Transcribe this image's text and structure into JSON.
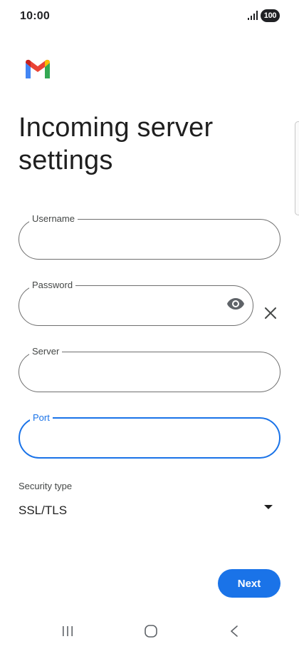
{
  "status_bar": {
    "time": "10:00",
    "battery": "100",
    "signal_icon": "signal-icon"
  },
  "app": {
    "logo": "gmail-logo",
    "brand_colors": {
      "blue": "#4285F4",
      "red": "#EA4335",
      "yellow": "#FBBC04",
      "green": "#34A853"
    }
  },
  "page": {
    "title": "Incoming server settings"
  },
  "form": {
    "username": {
      "label": "Username",
      "value": ""
    },
    "password": {
      "label": "Password",
      "value": "",
      "toggle_icon": "eye-icon",
      "clear_icon": "close-icon"
    },
    "server": {
      "label": "Server",
      "value": ""
    },
    "port": {
      "label": "Port",
      "value": "",
      "focused": true
    },
    "security": {
      "label": "Security type",
      "value": "SSL/TLS",
      "icon": "dropdown-arrow-icon"
    }
  },
  "actions": {
    "next_label": "Next"
  },
  "nav": {
    "recents_icon": "recents-icon",
    "home_icon": "home-icon",
    "back_icon": "back-icon"
  },
  "colors": {
    "accent": "#1a73e8",
    "outline": "#6f6f6f",
    "text": "#1f1f1f"
  }
}
